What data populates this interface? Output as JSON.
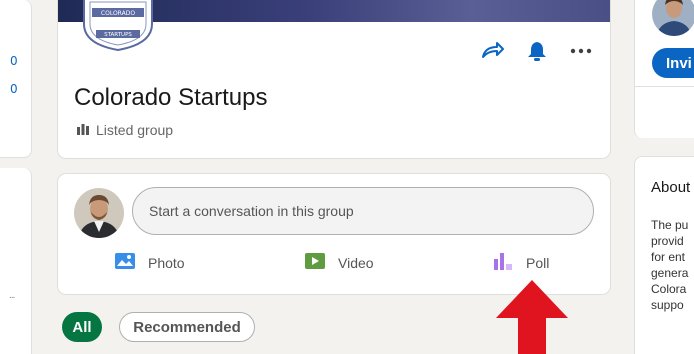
{
  "left_sidebar": {
    "numbers": [
      "0",
      "0"
    ],
    "more": "..."
  },
  "group": {
    "logo_text_top": "COLORADO",
    "logo_text_bottom": "STARTUPS",
    "title": "Colorado Startups",
    "type_label": "Listed group"
  },
  "composer": {
    "placeholder": "Start a conversation in this group",
    "buttons": [
      {
        "label": "Photo",
        "icon": "photo-icon",
        "color": "#378fe9"
      },
      {
        "label": "Video",
        "icon": "video-icon",
        "color": "#5f9b41"
      },
      {
        "label": "Poll",
        "icon": "poll-icon",
        "color": "#a872e8"
      }
    ]
  },
  "filters": {
    "all": "All",
    "recommended": "Recommended"
  },
  "right_panel": {
    "invite_label": "Invi",
    "about_title": "About",
    "about_lines": [
      "The pu",
      "provid",
      "for ent",
      "genera",
      "Colora",
      "suppo"
    ]
  },
  "colors": {
    "brand_blue": "#0a66c2",
    "active_green": "#057642",
    "annotation_red": "#e0141e"
  }
}
